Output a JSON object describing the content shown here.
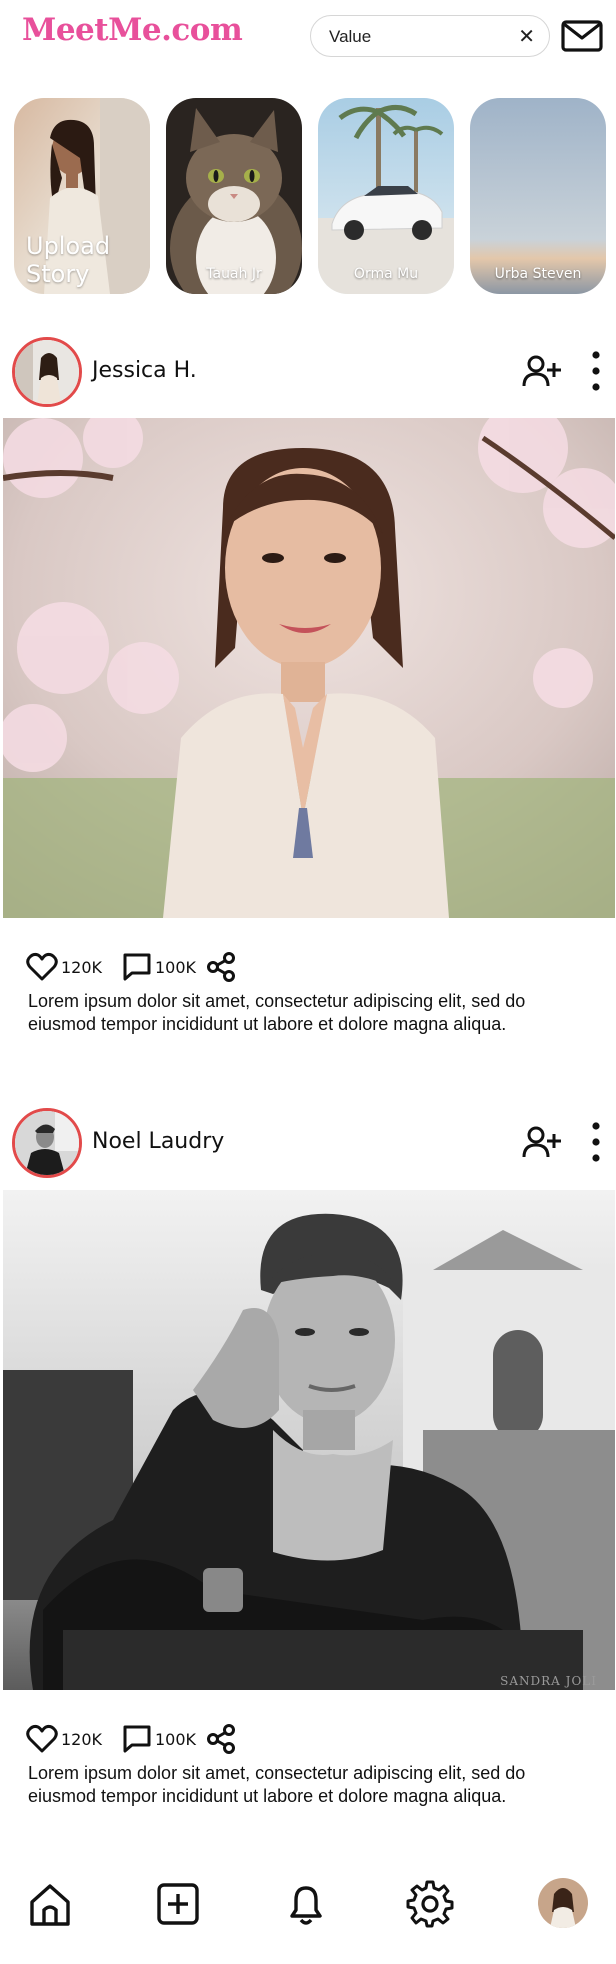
{
  "header": {
    "logo": "MeetMe.com",
    "search": {
      "value": "Value",
      "clear_icon": "close-icon"
    },
    "mail_icon": "mail-icon"
  },
  "stories": [
    {
      "label": "Upload Story"
    },
    {
      "label": "Tauah Jr"
    },
    {
      "label": "Orma Mu"
    },
    {
      "label": "Urba Steven"
    }
  ],
  "posts": [
    {
      "username": "Jessica H.",
      "likes": "120K",
      "comments": "100K",
      "caption": "Lorem ipsum dolor sit amet, consectetur adipiscing elit, sed do eiusmod  tempor incididunt ut labore et dolore magna aliqua."
    },
    {
      "username": "Noel Laudry",
      "likes": "120K",
      "comments": "100K",
      "caption": "Lorem ipsum dolor sit amet, consectetur adipiscing elit, sed do eiusmod  tempor incididunt ut labore et dolore magna aliqua.",
      "photo_watermark": "SANDRA JOLI"
    }
  ],
  "nav": {
    "items": [
      "home-icon",
      "add-post-icon",
      "bell-icon",
      "gear-icon",
      "profile-avatar"
    ]
  },
  "colors": {
    "logo": "#e8509b",
    "avatar_ring": "#e24a4a",
    "text": "#111111"
  }
}
